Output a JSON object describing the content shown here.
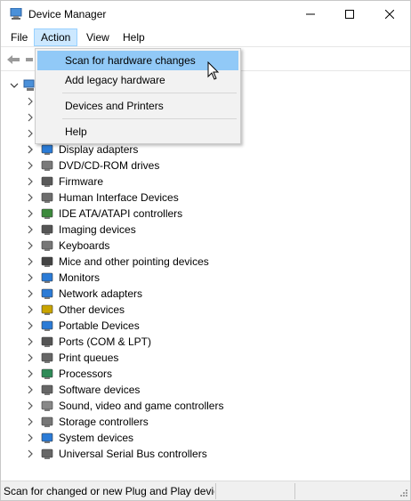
{
  "window": {
    "title": "Device Manager"
  },
  "menubar": {
    "items": [
      "File",
      "Action",
      "View",
      "Help"
    ]
  },
  "action_menu": {
    "items": [
      "Scan for hardware changes",
      "Add legacy hardware",
      "Devices and Printers",
      "Help"
    ]
  },
  "tree": {
    "categories": [
      "Display adapters",
      "DVD/CD-ROM drives",
      "Firmware",
      "Human Interface Devices",
      "IDE ATA/ATAPI controllers",
      "Imaging devices",
      "Keyboards",
      "Mice and other pointing devices",
      "Monitors",
      "Network adapters",
      "Other devices",
      "Portable Devices",
      "Ports (COM & LPT)",
      "Print queues",
      "Processors",
      "Software devices",
      "Sound, video and game controllers",
      "Storage controllers",
      "System devices",
      "Universal Serial Bus controllers"
    ]
  },
  "status": {
    "text": "Scan for changed or new Plug and Play devic"
  },
  "colors": {
    "highlight": "#91c9f7",
    "menu_active": "#cce8ff",
    "menu_bg": "#f2f2f2"
  }
}
